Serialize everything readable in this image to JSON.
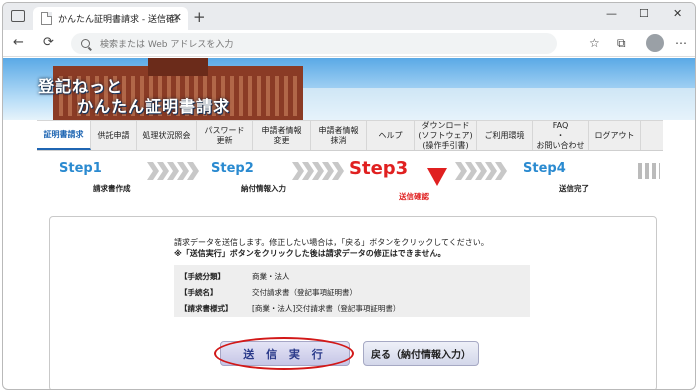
{
  "browser": {
    "tab_title": "かんたん証明書請求 - 送信確認",
    "tab_close": "✕",
    "new_tab": "+",
    "window_controls": [
      "—",
      "☐",
      "✕"
    ],
    "nav": {
      "back": "←",
      "reload": "⟳"
    },
    "address_placeholder": "検索または Web アドレスを入力"
  },
  "banner": {
    "line1": "登記ねっと",
    "line2": "かんたん証明書請求"
  },
  "menu": [
    {
      "label": "証明書請求",
      "active": true
    },
    {
      "label": "供託申請",
      "active": false
    },
    {
      "label": "処理状況照会",
      "active": false
    },
    {
      "label": "パスワード\n更新",
      "active": false
    },
    {
      "label": "申請者情報\n変更",
      "active": false
    },
    {
      "label": "申請者情報\n抹消",
      "active": false
    },
    {
      "label": "ヘルプ",
      "active": false
    },
    {
      "label": "ダウンロード\n(ソフトウェア)\n(操作手引書)",
      "active": false
    },
    {
      "label": "ご利用環境",
      "active": false
    },
    {
      "label": "FAQ\n・\nお問い合わせ",
      "active": false
    },
    {
      "label": "ログアウト",
      "active": false
    }
  ],
  "steps": [
    {
      "label": "Step1",
      "sub": "請求書作成"
    },
    {
      "label": "Step2",
      "sub": "納付情報入力"
    },
    {
      "label": "Step3",
      "sub": "送信確認"
    },
    {
      "label": "Step4",
      "sub": "送信完了"
    }
  ],
  "content": {
    "message1": "請求データを送信します。修正したい場合は，「戻る」ボタンをクリックしてください。",
    "message2": "※「送信実行」ボタンをクリックした後は請求データの修正はできません。",
    "rows": [
      {
        "key": "【手続分類】",
        "value": "商業・法人"
      },
      {
        "key": "【手続名】",
        "value": "交付請求書（登記事項証明書）"
      },
      {
        "key": "【請求書様式】",
        "value": "[商業・法人]交付請求書（登記事項証明書）"
      }
    ],
    "exec_button": "送 信 実 行",
    "back_button": "戻る（納付情報入力）"
  },
  "colors": {
    "accent": "#1f66b3",
    "step": "#2a8ad0",
    "current": "#e02020"
  }
}
